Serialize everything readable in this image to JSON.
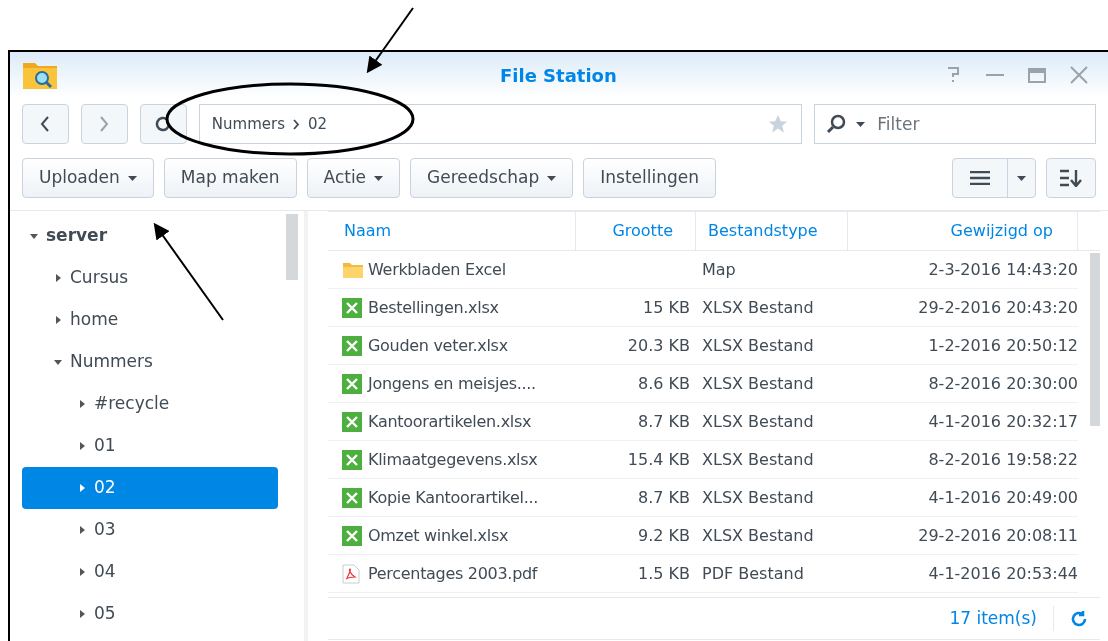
{
  "window": {
    "title": "File Station"
  },
  "toolbar": {
    "path": [
      "Nummers",
      "02"
    ],
    "filter": {
      "placeholder": "Filter"
    }
  },
  "actions": [
    {
      "label": "Uploaden",
      "dropdown": true
    },
    {
      "label": "Map maken",
      "dropdown": false
    },
    {
      "label": "Actie",
      "dropdown": true
    },
    {
      "label": "Gereedschap",
      "dropdown": true
    },
    {
      "label": "Instellingen",
      "dropdown": false
    }
  ],
  "tree": [
    {
      "label": "server",
      "expanded": true,
      "selected": false,
      "children": [
        {
          "label": "Cursus",
          "expanded": false,
          "selected": false
        },
        {
          "label": "home",
          "expanded": false,
          "selected": false
        },
        {
          "label": "Nummers",
          "expanded": true,
          "selected": false,
          "children": [
            {
              "label": "#recycle",
              "expanded": false,
              "selected": false
            },
            {
              "label": "01",
              "expanded": false,
              "selected": false
            },
            {
              "label": "02",
              "expanded": false,
              "selected": true
            },
            {
              "label": "03",
              "expanded": false,
              "selected": false
            },
            {
              "label": "04",
              "expanded": false,
              "selected": false
            },
            {
              "label": "05",
              "expanded": false,
              "selected": false
            }
          ]
        }
      ]
    }
  ],
  "table": {
    "columns": [
      "Naam",
      "Grootte",
      "Bestandstype",
      "Gewijzigd op"
    ],
    "rows": [
      {
        "kind": "folder",
        "name": "Werkbladen Excel",
        "size": "",
        "type": "Map",
        "modified": "2-3-2016 14:43:20"
      },
      {
        "kind": "xlsx",
        "name": "Bestellingen.xlsx",
        "size": "15 KB",
        "type": "XLSX Bestand",
        "modified": "29-2-2016 20:43:20"
      },
      {
        "kind": "xlsx",
        "name": "Gouden veter.xlsx",
        "size": "20.3 KB",
        "type": "XLSX Bestand",
        "modified": "1-2-2016 20:50:12"
      },
      {
        "kind": "xlsx",
        "name": "Jongens en meisjes....",
        "size": "8.6 KB",
        "type": "XLSX Bestand",
        "modified": "8-2-2016 20:30:00"
      },
      {
        "kind": "xlsx",
        "name": "Kantoorartikelen.xlsx",
        "size": "8.7 KB",
        "type": "XLSX Bestand",
        "modified": "4-1-2016 20:32:17"
      },
      {
        "kind": "xlsx",
        "name": "Klimaatgegevens.xlsx",
        "size": "15.4 KB",
        "type": "XLSX Bestand",
        "modified": "8-2-2016 19:58:22"
      },
      {
        "kind": "xlsx",
        "name": "Kopie Kantoorartikel...",
        "size": "8.7 KB",
        "type": "XLSX Bestand",
        "modified": "4-1-2016 20:49:00"
      },
      {
        "kind": "xlsx",
        "name": "Omzet winkel.xlsx",
        "size": "9.2 KB",
        "type": "XLSX Bestand",
        "modified": "29-2-2016 20:08:11"
      },
      {
        "kind": "pdf",
        "name": "Percentages 2003.pdf",
        "size": "1.5 KB",
        "type": "PDF Bestand",
        "modified": "4-1-2016 20:53:44"
      }
    ]
  },
  "status_bar": {
    "count": "17 item(s)"
  }
}
